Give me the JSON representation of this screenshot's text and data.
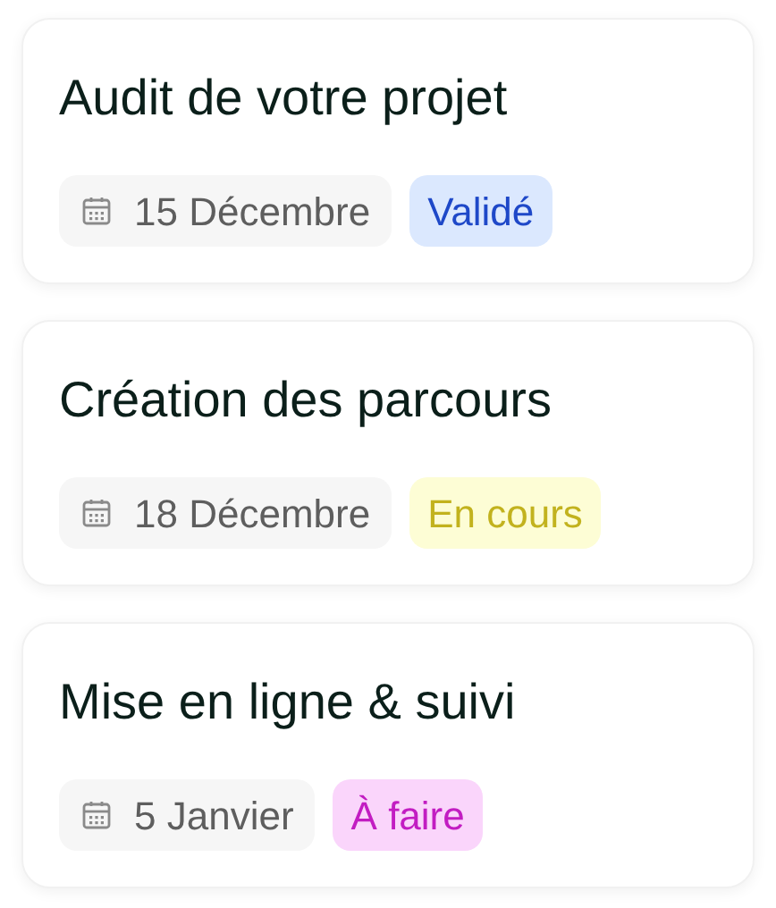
{
  "tasks": [
    {
      "title": "Audit de votre projet",
      "date": "15 Décembre",
      "status": {
        "label": "Validé",
        "kind": "done"
      }
    },
    {
      "title": "Création des parcours",
      "date": "18 Décembre",
      "status": {
        "label": "En cours",
        "kind": "progress"
      }
    },
    {
      "title": "Mise en ligne & suivi",
      "date": "5 Janvier",
      "status": {
        "label": "À faire",
        "kind": "todo"
      }
    }
  ]
}
